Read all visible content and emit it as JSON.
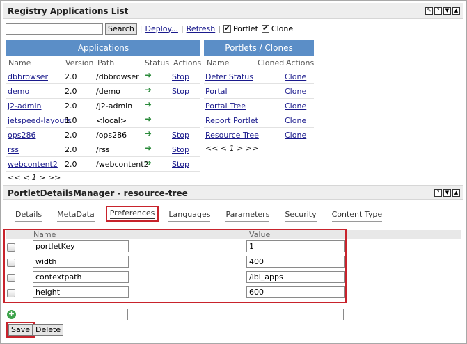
{
  "registry": {
    "title": "Registry Applications List",
    "search_button": "Search",
    "deploy_link": "Deploy...",
    "refresh_link": "Refresh",
    "portlet_checkbox_label": "Portlet",
    "clone_checkbox_label": "Clone",
    "separator": "|"
  },
  "applications": {
    "header": "Applications",
    "columns": [
      "Name",
      "Version",
      "Path",
      "Status",
      "Actions"
    ],
    "rows": [
      {
        "name": "dbbrowser",
        "version": "2.0",
        "path": "/dbbrowser",
        "action": "Stop"
      },
      {
        "name": "demo",
        "version": "2.0",
        "path": "/demo",
        "action": "Stop"
      },
      {
        "name": "j2-admin",
        "version": "2.0",
        "path": "/j2-admin",
        "action": ""
      },
      {
        "name": "jetspeed-layouts",
        "version": "1.0",
        "path": "<local>",
        "action": ""
      },
      {
        "name": "ops286",
        "version": "2.0",
        "path": "/ops286",
        "action": "Stop"
      },
      {
        "name": "rss",
        "version": "2.0",
        "path": "/rss",
        "action": "Stop"
      },
      {
        "name": "webcontent2",
        "version": "2.0",
        "path": "/webcontent2",
        "action": "Stop"
      }
    ],
    "pager": "<< < 1 > >>"
  },
  "portlets": {
    "header": "Portlets / Clones",
    "columns": [
      "Name",
      "Cloned",
      "Actions"
    ],
    "rows": [
      {
        "name": "Defer Status",
        "action": "Clone"
      },
      {
        "name": "Portal",
        "action": "Clone"
      },
      {
        "name": "Portal Tree",
        "action": "Clone"
      },
      {
        "name": "Report Portlet",
        "action": "Clone"
      },
      {
        "name": "Resource Tree",
        "action": "Clone"
      }
    ],
    "pager": "<< < 1 > >>"
  },
  "details": {
    "title": "PortletDetailsManager - resource-tree",
    "tabs": [
      "Details",
      "MetaData",
      "Preferences",
      "Languages",
      "Parameters",
      "Security",
      "Content Type"
    ],
    "active_tab": "Preferences",
    "columns": [
      "Name",
      "Value"
    ],
    "prefs": [
      {
        "name": "portletKey",
        "value": "1"
      },
      {
        "name": "width",
        "value": "400"
      },
      {
        "name": "contextpath",
        "value": "/ibi_apps"
      },
      {
        "name": "height",
        "value": "600"
      }
    ],
    "save_button": "Save",
    "delete_button": "Delete"
  },
  "colors": {
    "table_header": "#5b8ec7",
    "highlight": "#c8232c",
    "status_arrow": "#2a8a3a"
  }
}
